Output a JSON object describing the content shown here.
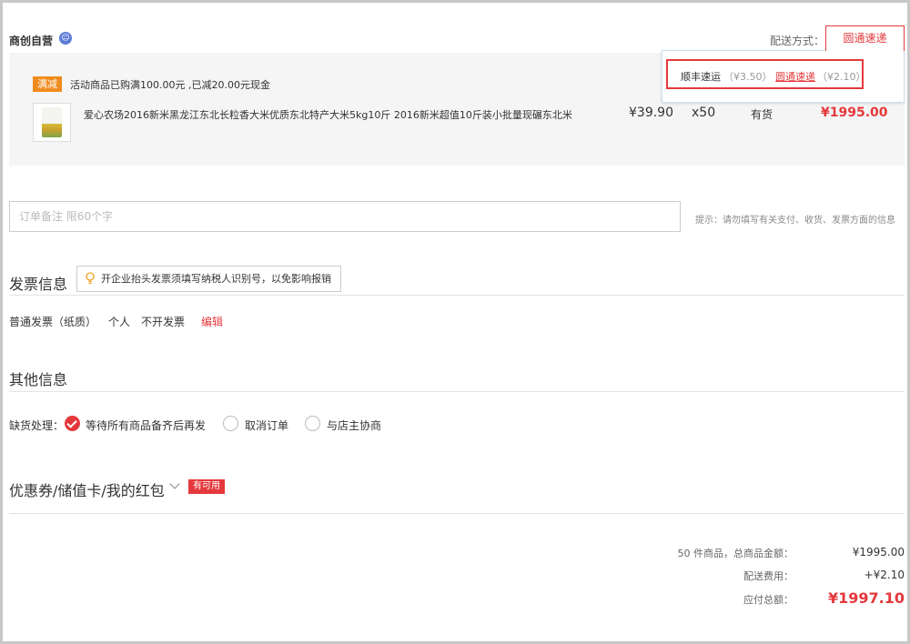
{
  "shop": {
    "name": "商创自营",
    "icon": "service-chat-icon"
  },
  "shipping": {
    "label": "配送方式：",
    "selected": "圆通速递",
    "options": [
      {
        "name": "顺丰速运",
        "price": "（¥3.50）"
      },
      {
        "name": "圆通速递",
        "price": "（¥2.10）"
      }
    ]
  },
  "promo": {
    "tag": "满减",
    "text": "活动商品已购满100.00元 ,已减20.00元现金"
  },
  "goods": {
    "name": "爱心农场2016新米黑龙江东北长粒香大米优质东北特产大米5kg10斤 2016新米超值10斤装小批量现碾东北米",
    "price": "¥39.90",
    "qty": "x50",
    "stock": "有货",
    "total": "¥1995.00"
  },
  "note": {
    "placeholder": "订单备注 限60个字",
    "value": "",
    "tip": "提示：请勿填写有关支付、收货、发票方面的信息"
  },
  "invoice": {
    "title": "发票信息",
    "tip": "开企业抬头发票须填写纳税人识别号，以免影响报销",
    "type": "普通发票（纸质）",
    "person": "个人",
    "content": "不开发票",
    "edit": "编辑"
  },
  "other": {
    "title": "其他信息",
    "stock_label": "缺货处理：",
    "options": [
      "等待所有商品备齐后再发",
      "取消订单",
      "与店主协商"
    ],
    "selected_index": 0
  },
  "coupon": {
    "title": "优惠券/储值卡/我的红包",
    "badge": "有可用"
  },
  "summary": {
    "count_label": "50 件商品，总商品金额：",
    "goods_amount": "¥1995.00",
    "shipping_label": "配送费用：",
    "shipping_amount": "+¥2.10",
    "total_label": "应付总额：",
    "total_amount": "¥1997.10"
  },
  "colors": {
    "accent": "#e4393c",
    "promo": "#f08c1e",
    "panel": "#f5f5f5"
  }
}
